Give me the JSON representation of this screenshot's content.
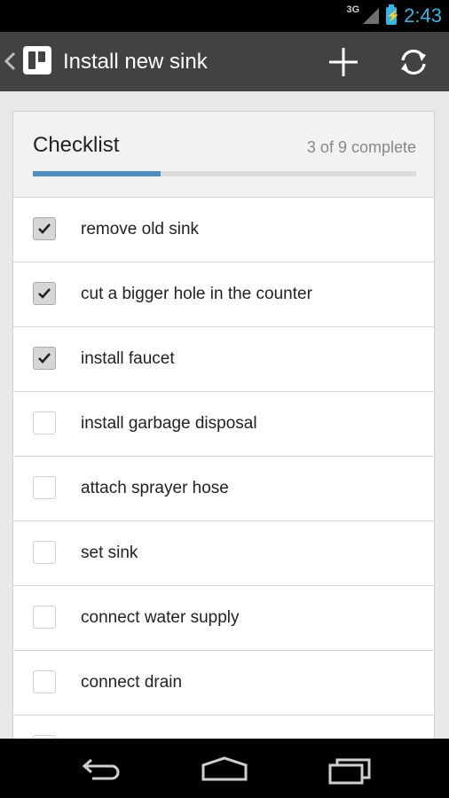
{
  "status_bar": {
    "network": "3G",
    "battery_icon": "battery-charging-icon",
    "time": "2:43"
  },
  "action_bar": {
    "title": "Install new sink",
    "icons": {
      "up": "chevron-left-icon",
      "logo": "trello-logo-icon",
      "add": "plus-icon",
      "sync": "sync-icon"
    }
  },
  "checklist": {
    "title": "Checklist",
    "progress_text": "3 of 9 complete",
    "progress_fraction": 0.333,
    "items": [
      {
        "label": "remove old sink",
        "checked": true
      },
      {
        "label": "cut a bigger hole in the counter",
        "checked": true
      },
      {
        "label": "install faucet",
        "checked": true
      },
      {
        "label": "install garbage disposal",
        "checked": false
      },
      {
        "label": "attach sprayer hose",
        "checked": false
      },
      {
        "label": "set sink",
        "checked": false
      },
      {
        "label": "connect water supply",
        "checked": false
      },
      {
        "label": "connect drain",
        "checked": false
      },
      {
        "label": "",
        "checked": false
      }
    ]
  },
  "nav_bar": {
    "icons": [
      "back-icon",
      "home-icon",
      "recents-icon"
    ]
  },
  "colors": {
    "accent": "#33b5e5",
    "progress": "#4a90c6",
    "action_bar": "#424242"
  }
}
